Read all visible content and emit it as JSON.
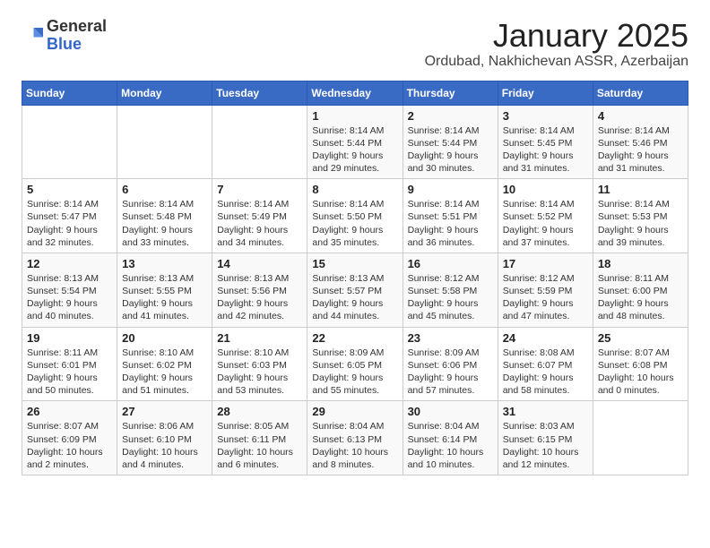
{
  "header": {
    "logo_general": "General",
    "logo_blue": "Blue",
    "month": "January 2025",
    "location": "Ordubad, Nakhichevan ASSR, Azerbaijan"
  },
  "weekdays": [
    "Sunday",
    "Monday",
    "Tuesday",
    "Wednesday",
    "Thursday",
    "Friday",
    "Saturday"
  ],
  "weeks": [
    [
      {
        "day": "",
        "info": ""
      },
      {
        "day": "",
        "info": ""
      },
      {
        "day": "",
        "info": ""
      },
      {
        "day": "1",
        "info": "Sunrise: 8:14 AM\nSunset: 5:44 PM\nDaylight: 9 hours\nand 29 minutes."
      },
      {
        "day": "2",
        "info": "Sunrise: 8:14 AM\nSunset: 5:44 PM\nDaylight: 9 hours\nand 30 minutes."
      },
      {
        "day": "3",
        "info": "Sunrise: 8:14 AM\nSunset: 5:45 PM\nDaylight: 9 hours\nand 31 minutes."
      },
      {
        "day": "4",
        "info": "Sunrise: 8:14 AM\nSunset: 5:46 PM\nDaylight: 9 hours\nand 31 minutes."
      }
    ],
    [
      {
        "day": "5",
        "info": "Sunrise: 8:14 AM\nSunset: 5:47 PM\nDaylight: 9 hours\nand 32 minutes."
      },
      {
        "day": "6",
        "info": "Sunrise: 8:14 AM\nSunset: 5:48 PM\nDaylight: 9 hours\nand 33 minutes."
      },
      {
        "day": "7",
        "info": "Sunrise: 8:14 AM\nSunset: 5:49 PM\nDaylight: 9 hours\nand 34 minutes."
      },
      {
        "day": "8",
        "info": "Sunrise: 8:14 AM\nSunset: 5:50 PM\nDaylight: 9 hours\nand 35 minutes."
      },
      {
        "day": "9",
        "info": "Sunrise: 8:14 AM\nSunset: 5:51 PM\nDaylight: 9 hours\nand 36 minutes."
      },
      {
        "day": "10",
        "info": "Sunrise: 8:14 AM\nSunset: 5:52 PM\nDaylight: 9 hours\nand 37 minutes."
      },
      {
        "day": "11",
        "info": "Sunrise: 8:14 AM\nSunset: 5:53 PM\nDaylight: 9 hours\nand 39 minutes."
      }
    ],
    [
      {
        "day": "12",
        "info": "Sunrise: 8:13 AM\nSunset: 5:54 PM\nDaylight: 9 hours\nand 40 minutes."
      },
      {
        "day": "13",
        "info": "Sunrise: 8:13 AM\nSunset: 5:55 PM\nDaylight: 9 hours\nand 41 minutes."
      },
      {
        "day": "14",
        "info": "Sunrise: 8:13 AM\nSunset: 5:56 PM\nDaylight: 9 hours\nand 42 minutes."
      },
      {
        "day": "15",
        "info": "Sunrise: 8:13 AM\nSunset: 5:57 PM\nDaylight: 9 hours\nand 44 minutes."
      },
      {
        "day": "16",
        "info": "Sunrise: 8:12 AM\nSunset: 5:58 PM\nDaylight: 9 hours\nand 45 minutes."
      },
      {
        "day": "17",
        "info": "Sunrise: 8:12 AM\nSunset: 5:59 PM\nDaylight: 9 hours\nand 47 minutes."
      },
      {
        "day": "18",
        "info": "Sunrise: 8:11 AM\nSunset: 6:00 PM\nDaylight: 9 hours\nand 48 minutes."
      }
    ],
    [
      {
        "day": "19",
        "info": "Sunrise: 8:11 AM\nSunset: 6:01 PM\nDaylight: 9 hours\nand 50 minutes."
      },
      {
        "day": "20",
        "info": "Sunrise: 8:10 AM\nSunset: 6:02 PM\nDaylight: 9 hours\nand 51 minutes."
      },
      {
        "day": "21",
        "info": "Sunrise: 8:10 AM\nSunset: 6:03 PM\nDaylight: 9 hours\nand 53 minutes."
      },
      {
        "day": "22",
        "info": "Sunrise: 8:09 AM\nSunset: 6:05 PM\nDaylight: 9 hours\nand 55 minutes."
      },
      {
        "day": "23",
        "info": "Sunrise: 8:09 AM\nSunset: 6:06 PM\nDaylight: 9 hours\nand 57 minutes."
      },
      {
        "day": "24",
        "info": "Sunrise: 8:08 AM\nSunset: 6:07 PM\nDaylight: 9 hours\nand 58 minutes."
      },
      {
        "day": "25",
        "info": "Sunrise: 8:07 AM\nSunset: 6:08 PM\nDaylight: 10 hours\nand 0 minutes."
      }
    ],
    [
      {
        "day": "26",
        "info": "Sunrise: 8:07 AM\nSunset: 6:09 PM\nDaylight: 10 hours\nand 2 minutes."
      },
      {
        "day": "27",
        "info": "Sunrise: 8:06 AM\nSunset: 6:10 PM\nDaylight: 10 hours\nand 4 minutes."
      },
      {
        "day": "28",
        "info": "Sunrise: 8:05 AM\nSunset: 6:11 PM\nDaylight: 10 hours\nand 6 minutes."
      },
      {
        "day": "29",
        "info": "Sunrise: 8:04 AM\nSunset: 6:13 PM\nDaylight: 10 hours\nand 8 minutes."
      },
      {
        "day": "30",
        "info": "Sunrise: 8:04 AM\nSunset: 6:14 PM\nDaylight: 10 hours\nand 10 minutes."
      },
      {
        "day": "31",
        "info": "Sunrise: 8:03 AM\nSunset: 6:15 PM\nDaylight: 10 hours\nand 12 minutes."
      },
      {
        "day": "",
        "info": ""
      }
    ]
  ]
}
